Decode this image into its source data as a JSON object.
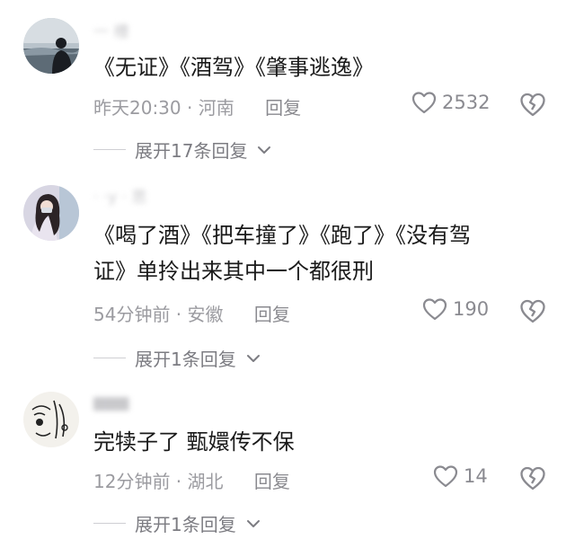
{
  "comments": [
    {
      "username": "一 槽",
      "text_lines": [
        "《无证》《酒驾》《肇事逃逸》"
      ],
      "time_location": "昨天20:30 · 河南",
      "reply_label": "回复",
      "likes": "2532",
      "expand_label": "展开17条回复"
    },
    {
      "username": "·  ·y · 思",
      "text_lines": [
        "《喝了酒》《把车撞了》《跑了》《没有驾",
        "证》单拎出来其中一个都很刑"
      ],
      "time_location": "54分钟前 · 安徽",
      "reply_label": "回复",
      "likes": "190",
      "expand_label": "展开1条回复"
    },
    {
      "username": "  ▆▆▆",
      "text_lines": [
        "完犊子了 甄嬛传不保"
      ],
      "time_location": "12分钟前 · 湖北",
      "reply_label": "回复",
      "likes": "14",
      "expand_label": "展开1条回复"
    }
  ],
  "icons": {
    "like": "heart-outline-icon",
    "dislike": "broken-heart-icon",
    "expand": "chevron-down-icon"
  },
  "colors": {
    "text": "#1a1a1a",
    "meta": "#9b9ba0",
    "icon": "#8a8a90"
  }
}
